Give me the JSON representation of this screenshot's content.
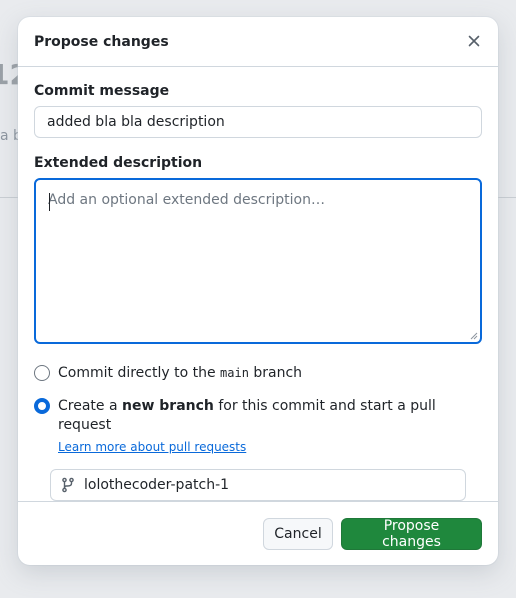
{
  "background": {
    "partial_number": "12",
    "partial_text": "a b"
  },
  "dialog": {
    "title": "Propose changes",
    "close_icon": "close-icon",
    "commit_message": {
      "label": "Commit message",
      "value": "added bla bla description"
    },
    "extended_description": {
      "label": "Extended description",
      "placeholder": "Add an optional extended description…"
    },
    "options": {
      "direct": {
        "prefix": "Commit directly to the ",
        "branch": "main",
        "suffix": " branch",
        "checked": false
      },
      "new_branch": {
        "prefix": "Create a ",
        "bold": "new branch",
        "suffix": " for this commit and start a pull request",
        "checked": true,
        "link": "Learn more about pull requests"
      }
    },
    "branch_name": {
      "icon": "git-branch-icon",
      "value": "lolothecoder-patch-1"
    },
    "buttons": {
      "cancel": "Cancel",
      "submit": "Propose changes"
    }
  },
  "colors": {
    "accent": "#0969da",
    "primary_button": "#1f883d"
  }
}
